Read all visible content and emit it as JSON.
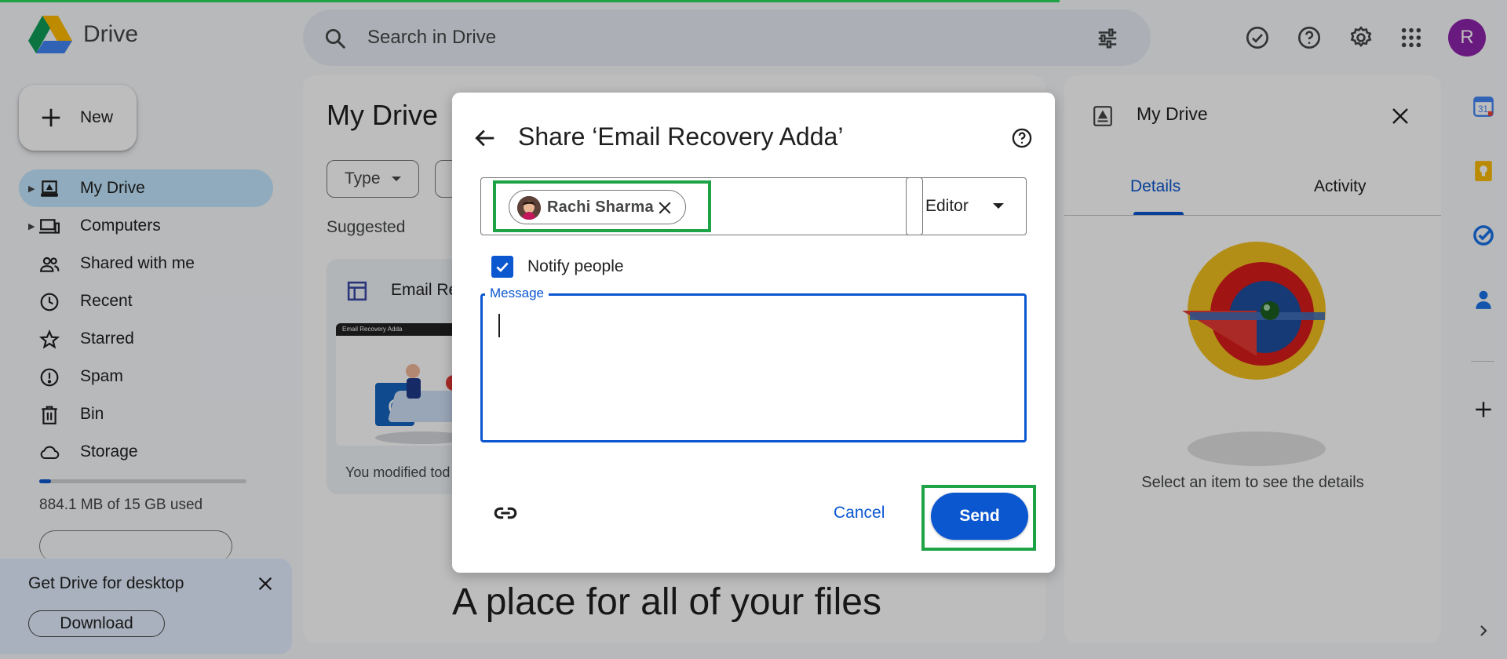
{
  "app": {
    "title": "Drive"
  },
  "search": {
    "placeholder": "Search in Drive"
  },
  "header": {
    "avatar_letter": "R"
  },
  "sidebar": {
    "new_label": "New",
    "items": [
      {
        "label": "My Drive",
        "icon": "my-drive-icon",
        "active": true
      },
      {
        "label": "Computers",
        "icon": "computers-icon"
      },
      {
        "label": "Shared with me",
        "icon": "shared-icon"
      },
      {
        "label": "Recent",
        "icon": "clock-icon"
      },
      {
        "label": "Starred",
        "icon": "star-icon"
      },
      {
        "label": "Spam",
        "icon": "spam-icon"
      },
      {
        "label": "Bin",
        "icon": "trash-icon"
      },
      {
        "label": "Storage",
        "icon": "cloud-icon"
      }
    ],
    "storage": {
      "text": "884.1 MB of 15 GB used",
      "fraction": 0.058
    }
  },
  "promo": {
    "title": "Get Drive for desktop",
    "button": "Download"
  },
  "main": {
    "title": "My Drive",
    "filters": [
      "Type"
    ],
    "suggested_label": "Suggested",
    "card": {
      "name": "Email Re",
      "thumb_header": "Email Recovery Adda",
      "modified": "You modified tod"
    },
    "empty_text": "A place for all of your files"
  },
  "details": {
    "title": "My Drive",
    "tabs": [
      "Details",
      "Activity"
    ],
    "empty_text": "Select an item to see the details"
  },
  "dialog": {
    "title": "Share ‘Email Recovery Adda’",
    "recipient": "Rachi Sharma",
    "role": "Editor",
    "notify_label": "Notify people",
    "notify_checked": true,
    "message_label": "Message",
    "cancel": "Cancel",
    "send": "Send"
  },
  "colors": {
    "accent": "#0b57d0",
    "highlight": "#1ea446",
    "active_nav": "#c2e7ff",
    "avatar": "#8e24aa"
  }
}
